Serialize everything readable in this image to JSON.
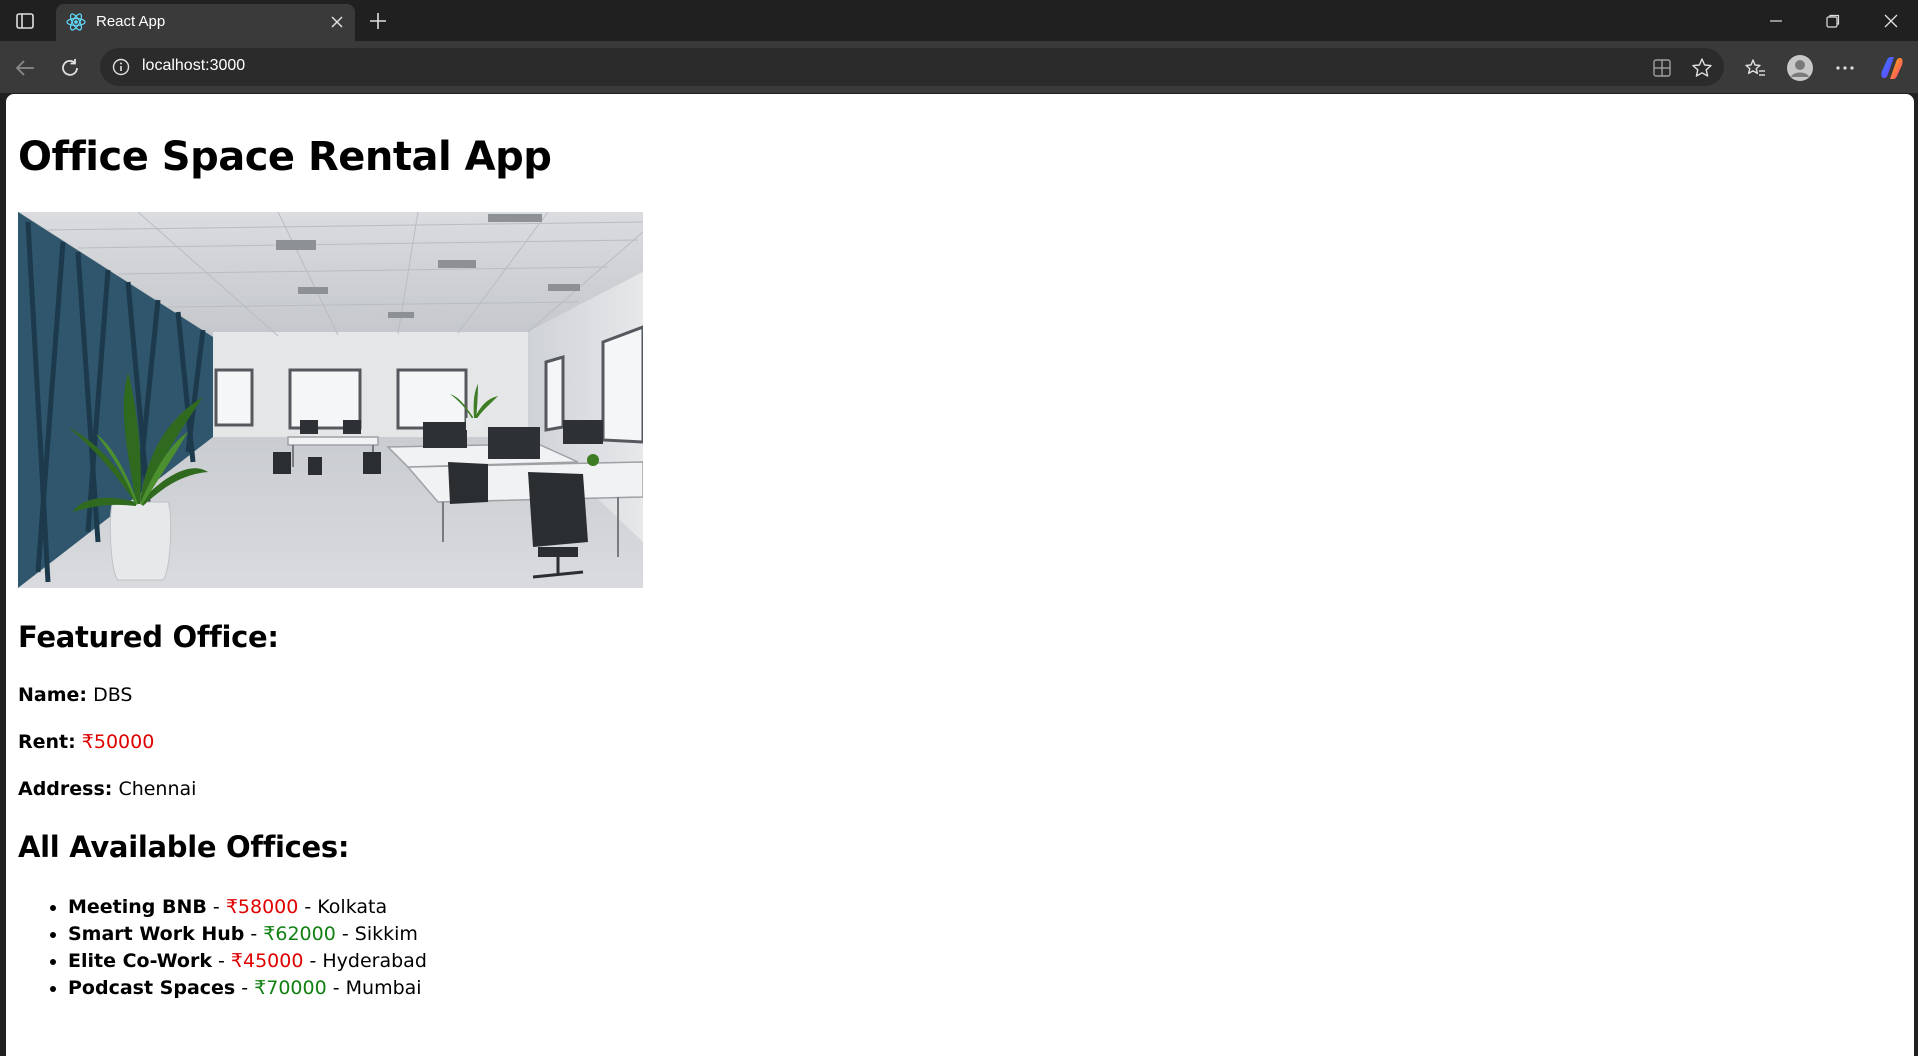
{
  "browser": {
    "tab_title": "React App",
    "url": "localhost:3000"
  },
  "page": {
    "title": "Office Space Rental App",
    "featured_heading": "Featured Office:",
    "featured": {
      "name_label": "Name:",
      "name": "DBS",
      "rent_label": "Rent:",
      "rent": "₹50000",
      "rent_color": "#e00000",
      "address_label": "Address:",
      "address": "Chennai"
    },
    "list_heading": "All Available Offices:",
    "offices": [
      {
        "name": "Meeting BNB",
        "rent": "₹58000",
        "city": "Kolkata",
        "rent_color": "#e00000"
      },
      {
        "name": "Smart Work Hub",
        "rent": "₹62000",
        "city": "Sikkim",
        "rent_color": "#128012"
      },
      {
        "name": "Elite Co-Work",
        "rent": "₹45000",
        "city": "Hyderabad",
        "rent_color": "#e00000"
      },
      {
        "name": "Podcast Spaces",
        "rent": "₹70000",
        "city": "Mumbai",
        "rent_color": "#128012"
      }
    ],
    "separator": " - "
  },
  "icons": {
    "tab": "react-logo-icon",
    "image": "office-interior-photo"
  }
}
